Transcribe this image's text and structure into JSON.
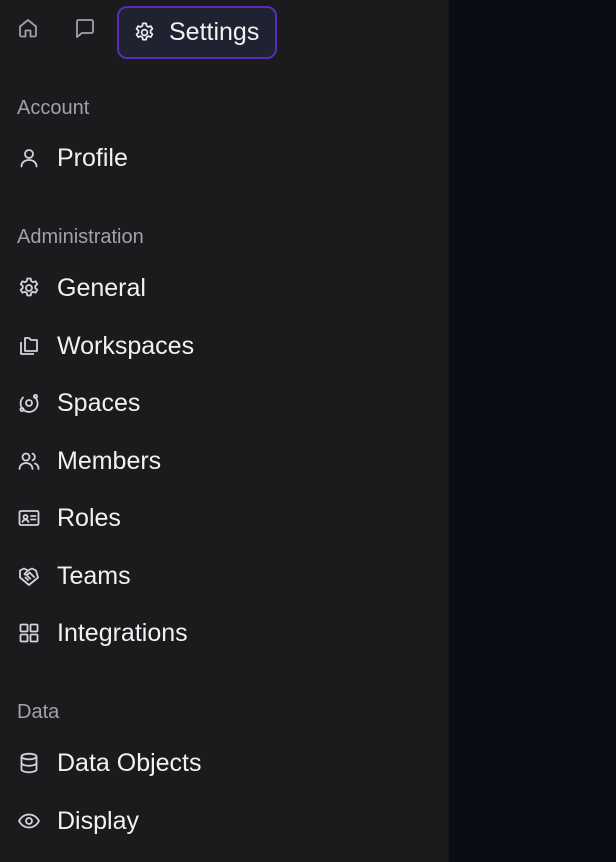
{
  "topbar": {
    "home_icon": "home-icon",
    "chat_icon": "chat-icon",
    "settings_label": "Settings"
  },
  "sections": {
    "account": "Account",
    "administration": "Administration",
    "data": "Data"
  },
  "nav": {
    "profile": "Profile",
    "general": "General",
    "workspaces": "Workspaces",
    "spaces": "Spaces",
    "members": "Members",
    "roles": "Roles",
    "teams": "Teams",
    "integrations": "Integrations",
    "data_objects": "Data Objects",
    "display": "Display"
  },
  "colors": {
    "sidebar_bg": "#1b1b1e",
    "main_bg": "#0a0d14",
    "accent_border": "#5b2bb5"
  }
}
